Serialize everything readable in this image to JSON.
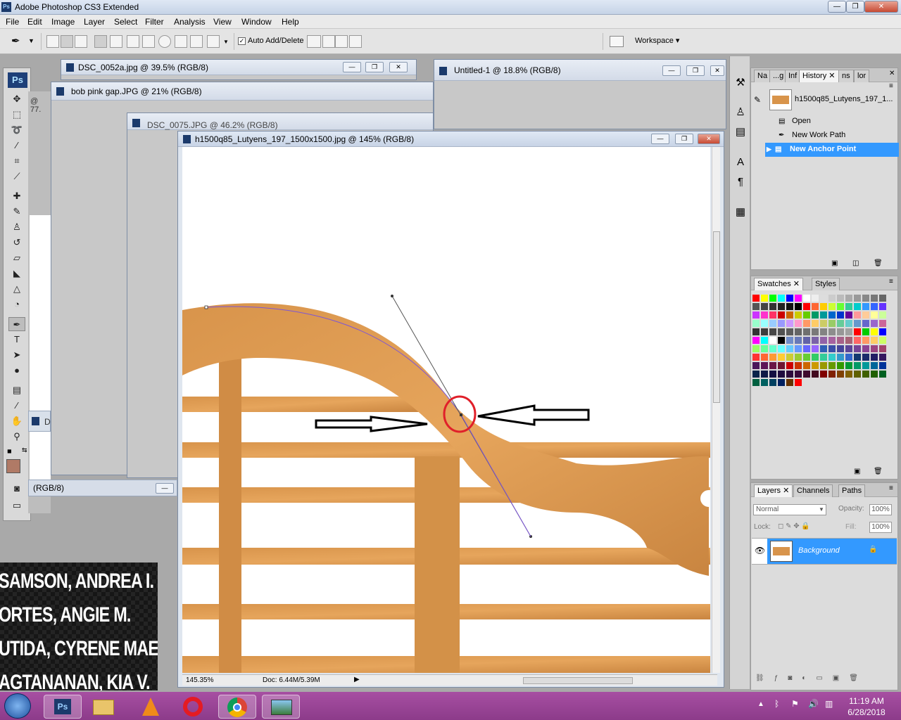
{
  "app": {
    "title": "Adobe Photoshop CS3 Extended",
    "logo_text": "Ps"
  },
  "window_controls": {
    "minimize": "—",
    "restore": "❐",
    "close": "✕"
  },
  "menu": [
    "File",
    "Edit",
    "Image",
    "Layer",
    "Select",
    "Filter",
    "Analysis",
    "View",
    "Window",
    "Help"
  ],
  "options_bar": {
    "auto_add_delete_label": "Auto Add/Delete",
    "auto_add_delete_checked": true,
    "workspace_label": "Workspace ▾"
  },
  "documents": {
    "dsc0052a": {
      "title": "DSC_0052a.jpg @ 39.5% (RGB/8)"
    },
    "untitled": {
      "title": "Untitled-1 @ 18.8% (RGB/8)"
    },
    "bob": {
      "title": "bob pink gap.JPG @ 21% (RGB/8)",
      "side_label": "@ 77."
    },
    "dsc0075": {
      "title": "DSC_0075.JPG @ 46.2% (RGB/8)"
    },
    "background_status": "(RGB/8)",
    "background_d": "D",
    "main": {
      "title": "h1500q85_Lutyens_197_1500x1500.jpg @ 145% (RGB/8)",
      "zoom": "145.35%",
      "doc_info": "Doc: 6.44M/5.39M"
    }
  },
  "history_panel": {
    "tabs": [
      "Na",
      "...g",
      "Inf",
      "History",
      "ns",
      "lor"
    ],
    "snapshot": "h1500q85_Lutyens_197_1...",
    "items": [
      {
        "label": "Open",
        "selected": false
      },
      {
        "label": "New Work Path",
        "selected": false
      },
      {
        "label": "New Anchor Point",
        "selected": true
      }
    ]
  },
  "swatches_panel": {
    "tabs": [
      "Swatches",
      "Styles"
    ],
    "colors": [
      "#ff0000",
      "#ffff00",
      "#00ff00",
      "#00ffff",
      "#0000ff",
      "#ff00ff",
      "#ffffff",
      "#eeeeee",
      "#dddddd",
      "#cccccc",
      "#bbbbbb",
      "#aaaaaa",
      "#999999",
      "#888888",
      "#777777",
      "#666666",
      "#555555",
      "#444444",
      "#333333",
      "#222222",
      "#111111",
      "#000000",
      "#ff0000",
      "#ff6633",
      "#ffcc00",
      "#ccff33",
      "#66ff33",
      "#33cc99",
      "#00cccc",
      "#3399ff",
      "#3366ff",
      "#6633ff",
      "#cc33ff",
      "#ff33cc",
      "#ff3366",
      "#cc0000",
      "#cc6600",
      "#cccc00",
      "#66cc00",
      "#009966",
      "#009999",
      "#0066cc",
      "#0033cc",
      "#660099",
      "#ff9999",
      "#ffcc99",
      "#ffff99",
      "#ccff99",
      "#99ffcc",
      "#99ffff",
      "#99ccff",
      "#9999ff",
      "#cc99ff",
      "#ff99cc",
      "#ff9966",
      "#ffcc66",
      "#cccc66",
      "#99cc66",
      "#66cc99",
      "#66cccc",
      "#6699cc",
      "#6666cc",
      "#9966cc",
      "#cc6699",
      "#cc6666",
      "#996633",
      "#996600",
      "#999900",
      "#669900",
      "#006633",
      "#006666",
      "#003399",
      "#330099",
      "#660066",
      "#990033",
      "#990000",
      "#663300",
      "#666600",
      "#336600",
      "#003300",
      "#003333",
      "#001f66",
      "#1a0066",
      "#330033",
      "#66001a",
      "#330000",
      "#4d3319",
      "#808080"
    ],
    "lower_colors": [
      "#333333",
      "#3d3d3d",
      "#474747",
      "#515151",
      "#5b5b5b",
      "#656565",
      "#6f6f6f",
      "#797979",
      "#838383",
      "#8d8d8d",
      "#979797",
      "#a1a1a1",
      "#ff0000",
      "#00cc00",
      "#ffff00",
      "#0000ff",
      "#ff00ff",
      "#00ffff",
      "#ffffff",
      "#000000",
      "#6f8cc9",
      "#6879b8",
      "#6262a7",
      "#7a62a7",
      "#9262a7",
      "#a762a0",
      "#a7628a",
      "#a76276",
      "#ff6666",
      "#ff9966",
      "#ffcc66",
      "#ccff66",
      "#99ff66",
      "#66ff99",
      "#66ffcc",
      "#66ffff",
      "#66ccff",
      "#6699ff",
      "#6666ff",
      "#9966ff",
      "#2f5fb5",
      "#3a4ea8",
      "#45449a",
      "#5c4498",
      "#754496",
      "#8c4493",
      "#9b4480",
      "#a2446b",
      "#ff3333",
      "#ff6633",
      "#ff9933",
      "#ffcc33",
      "#cccc33",
      "#99cc33",
      "#66cc33",
      "#33cc66",
      "#33cc99",
      "#33cccc",
      "#3399cc",
      "#3366cc",
      "#13386f",
      "#1b2c6a",
      "#221d64",
      "#36175f",
      "#4b175b",
      "#5e1657",
      "#6b1646",
      "#6f1531",
      "#cc0000",
      "#cc3300",
      "#cc6600",
      "#cc9900",
      "#999900",
      "#669900",
      "#339900",
      "#009933",
      "#009966",
      "#009999",
      "#006699",
      "#003399",
      "#0a234a",
      "#0f1a46",
      "#130f42",
      "#1f0b3f",
      "#2c0b3c",
      "#370a39",
      "#3f0a2e",
      "#420a1e",
      "#800000",
      "#802000",
      "#804000",
      "#806000",
      "#606000",
      "#406000",
      "#206000",
      "#006020",
      "#006040",
      "#006060",
      "#004060",
      "#002060",
      "#663300",
      "#ff0000"
    ]
  },
  "layers_panel": {
    "tabs": [
      "Layers",
      "Channels",
      "Paths"
    ],
    "blend_mode": "Normal",
    "opacity_label": "Opacity:",
    "opacity_value": "100%",
    "lock_label": "Lock:",
    "fill_label": "Fill:",
    "fill_value": "100%",
    "layer_name": "Background"
  },
  "names_list": [
    "SAMSON, ANDREA I.",
    "ORTES, ANGIE M.",
    "UTIDA, CYRENE MAEVE G.",
    "AGTANANAN, KIA V."
  ],
  "clock": {
    "time": "11:19 AM",
    "date": "6/28/2018"
  }
}
